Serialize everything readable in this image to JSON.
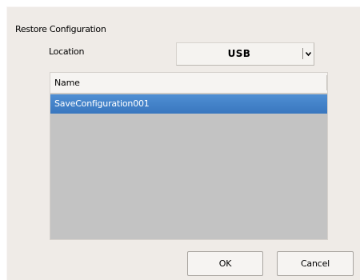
{
  "dialog": {
    "title": "Restore Configuration",
    "location_label": "Location",
    "location_value": "USB",
    "dropdown_icon": "chevron-down-icon"
  },
  "file_list": {
    "column_header": "Name",
    "items": [
      {
        "name": "SaveConfiguration001",
        "selected": true
      }
    ]
  },
  "buttons": {
    "ok_label": "OK",
    "cancel_label": "Cancel"
  },
  "colors": {
    "dialog_background": "#efebe7",
    "list_background": "#c3c3c3",
    "selection": "#3f80c6",
    "selection_text": "#ffffff"
  }
}
